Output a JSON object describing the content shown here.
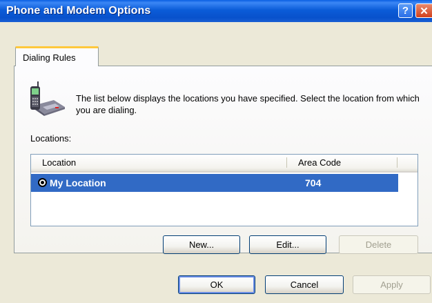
{
  "window": {
    "title": "Phone and Modem Options",
    "help_glyph": "?",
    "close_glyph": "✕"
  },
  "tabs": [
    {
      "label": "Dialing Rules"
    }
  ],
  "panel": {
    "icon": "phone-modem-icon",
    "description": "The list below displays the locations you have specified. Select the location from which you are dialing.",
    "locations_label": "Locations:",
    "list": {
      "columns": [
        "Location",
        "Area Code"
      ],
      "rows": [
        {
          "location": "My Location",
          "area_code": "704",
          "selected": true
        }
      ]
    },
    "buttons": {
      "new": "New...",
      "edit": "Edit...",
      "delete": "Delete"
    }
  },
  "footer": {
    "ok": "OK",
    "cancel": "Cancel",
    "apply": "Apply"
  },
  "colors": {
    "titlebar": "#0b5cd8",
    "selection": "#316ac5",
    "face": "#ece9d8"
  }
}
